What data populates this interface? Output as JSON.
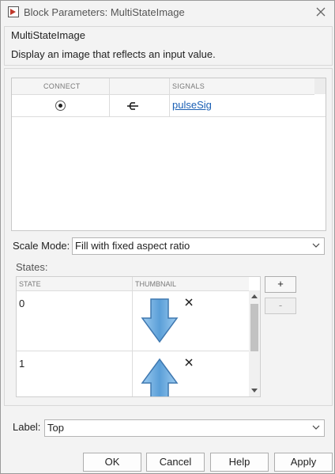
{
  "window": {
    "title": "Block Parameters: MultiStateImage"
  },
  "description": {
    "block_name": "MultiStateImage",
    "text": "Display an image that reflects an input value."
  },
  "signals_table": {
    "headers": [
      "CONNECT",
      "",
      "SIGNALS"
    ],
    "rows": [
      {
        "connected": true,
        "signal": "pulseSig"
      }
    ]
  },
  "scale_mode": {
    "label": "Scale Mode:",
    "value": "Fill with fixed aspect ratio"
  },
  "states": {
    "label": "States:",
    "headers": [
      "STATE",
      "THUMBNAIL"
    ],
    "rows": [
      {
        "state": "0",
        "thumbnail": "down-arrow-icon"
      },
      {
        "state": "1",
        "thumbnail": "up-arrow-icon"
      }
    ],
    "add_label": "+",
    "remove_label": "-"
  },
  "label_field": {
    "label": "Label:",
    "value": "Top"
  },
  "buttons": {
    "ok": "OK",
    "cancel": "Cancel",
    "help": "Help",
    "apply": "Apply"
  },
  "colors": {
    "link": "#1a5fb4",
    "arrow_fill": "#7db8e8",
    "arrow_stroke": "#3f78b0"
  }
}
